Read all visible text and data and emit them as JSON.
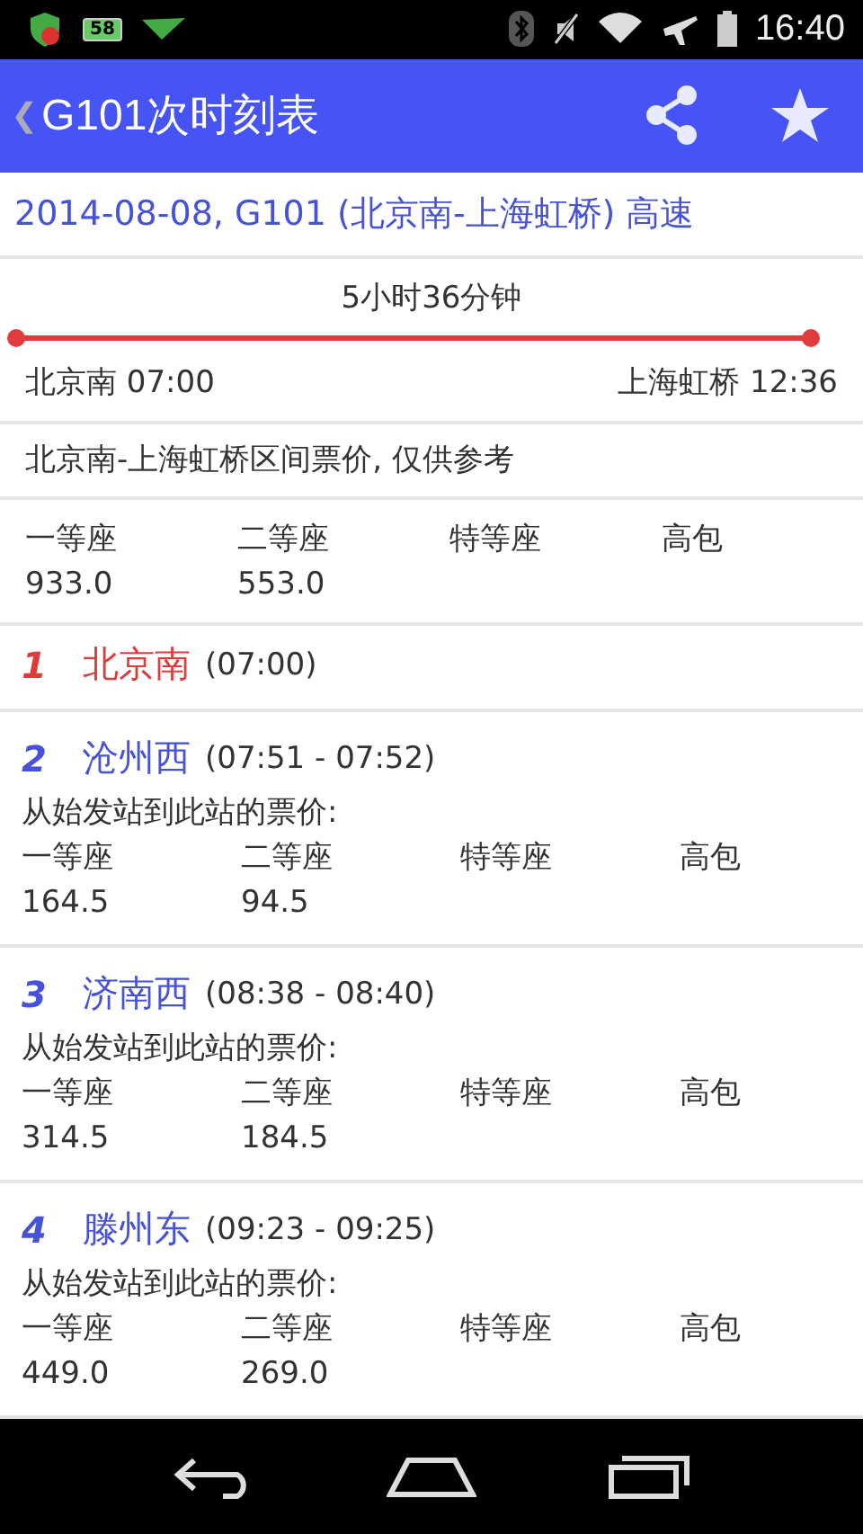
{
  "status_bar": {
    "battery_badge": "58",
    "time": "16:40"
  },
  "app_bar": {
    "back": "❮",
    "title": "G101次时刻表"
  },
  "summary": "2014-08-08, G101 (北京南-上海虹桥) 高速",
  "journey": {
    "duration": "5小时36分钟",
    "from": "北京南 07:00",
    "to": "上海虹桥 12:36"
  },
  "fare_note": "北京南-上海虹桥区间票价, 仅供参考",
  "fares": {
    "columns": [
      "一等座",
      "二等座",
      "特等座",
      "高包"
    ],
    "values": [
      "933.0",
      "553.0"
    ]
  },
  "stations": [
    {
      "kind": "origin",
      "number": "1",
      "name": "北京南",
      "time": "(07:00)"
    },
    {
      "kind": "stop",
      "number": "2",
      "name": "沧州西",
      "time": "(07:51 - 07:52)",
      "fare_label": "从始发站到此站的票价:",
      "columns": [
        "一等座",
        "二等座",
        "特等座",
        "高包"
      ],
      "values": [
        "164.5",
        "94.5"
      ]
    },
    {
      "kind": "stop",
      "number": "3",
      "name": "济南西",
      "time": "(08:38 - 08:40)",
      "fare_label": "从始发站到此站的票价:",
      "columns": [
        "一等座",
        "二等座",
        "特等座",
        "高包"
      ],
      "values": [
        "314.5",
        "184.5"
      ]
    },
    {
      "kind": "stop",
      "number": "4",
      "name": "滕州东",
      "time": "(09:23 - 09:25)",
      "fare_label": "从始发站到此站的票价:",
      "columns": [
        "一等座",
        "二等座",
        "特等座",
        "高包"
      ],
      "values": [
        "449.0",
        "269.0"
      ]
    }
  ]
}
